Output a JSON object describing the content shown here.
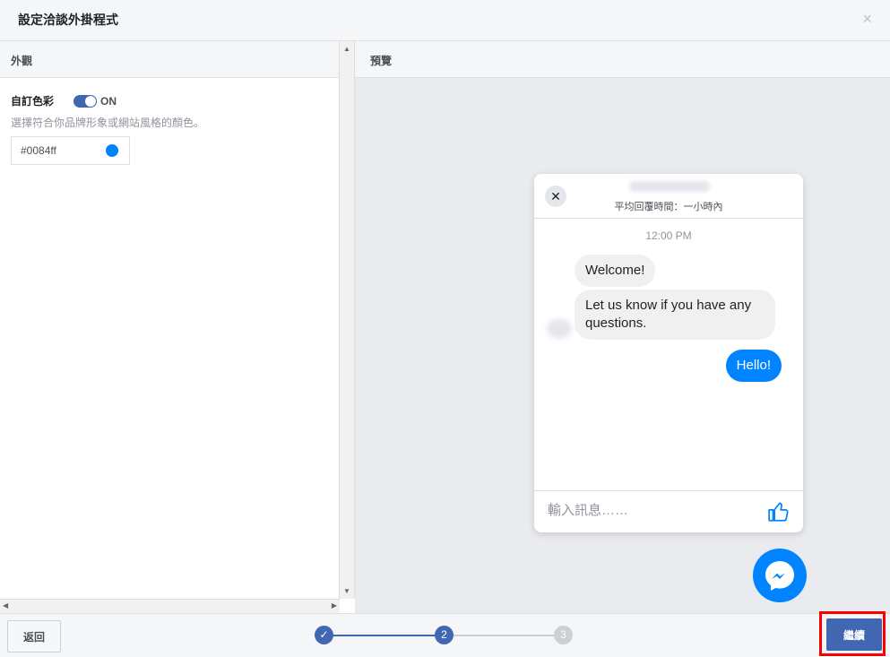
{
  "dialog": {
    "title": "設定洽談外掛程式",
    "close_glyph": "×"
  },
  "appearance": {
    "section_title": "外觀",
    "custom_color_label": "自訂色彩",
    "toggle_state": "ON",
    "hint": "選擇符合你品牌形象或網站風格的顏色。",
    "color_value": "#0084ff",
    "swatch_color": "#0084ff"
  },
  "preview": {
    "section_title": "預覽",
    "response_time": "平均回覆時間：一小時內",
    "timestamp": "12:00 PM",
    "messages": [
      {
        "from": "page",
        "text": "Welcome!"
      },
      {
        "from": "page",
        "text": "Let us know if you have any questions."
      },
      {
        "from": "user",
        "text": "Hello!"
      }
    ],
    "input_placeholder": "輸入訊息……",
    "accent_color": "#0084ff"
  },
  "footer": {
    "back_label": "返回",
    "next_label": "繼續",
    "steps": [
      {
        "label": "✓",
        "state": "done"
      },
      {
        "label": "2",
        "state": "current"
      },
      {
        "label": "3",
        "state": "pending"
      }
    ]
  },
  "icons": [
    "close-icon",
    "chevron-up-icon",
    "chevron-down-icon",
    "chevron-left-icon",
    "chevron-right-icon",
    "like-icon",
    "messenger-icon",
    "check-icon"
  ]
}
